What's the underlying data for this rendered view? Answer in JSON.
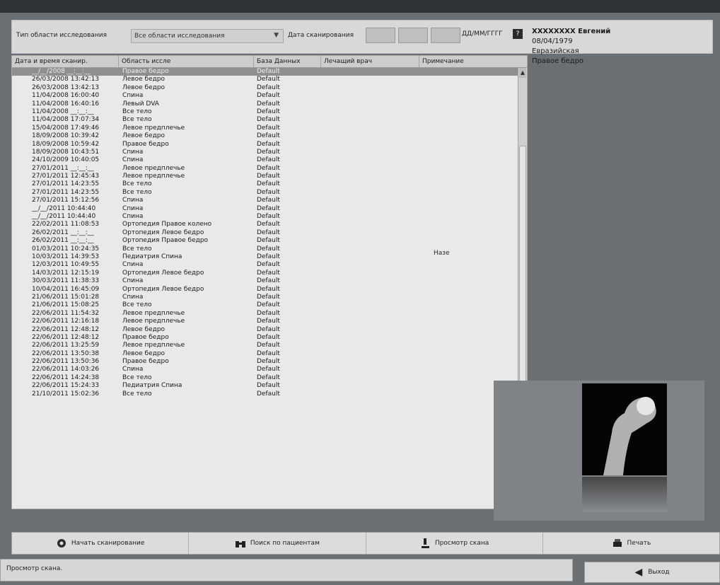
{
  "filters": {
    "exam_type_label": "Тип области исследования",
    "exam_type_value": "Все области исследования",
    "scan_date_label": "Дата сканирования",
    "date_format": "ДД/ММ/ГГГГ"
  },
  "patient": {
    "name": "XXXXXXXX Евгений",
    "dob": "08/04/1979",
    "ethnicity": "Евразийская",
    "region": "Правое бедро"
  },
  "table": {
    "headers": [
      "Дата и время сканир.",
      "Область иссле",
      "База Данных",
      "Лечащий врач",
      "Примечание"
    ],
    "comment": "Назе",
    "rows": [
      [
        "__/__/2008 __:__:__",
        "Правое бедро",
        "Default"
      ],
      [
        "26/03/2008 13:42:13",
        "Левое бедро",
        "Default"
      ],
      [
        "26/03/2008 13:42:13",
        "Левое бедро",
        "Default"
      ],
      [
        "11/04/2008 16:00:40",
        "Спина",
        "Default"
      ],
      [
        "11/04/2008 16:40:16",
        "Левый DVA",
        "Default"
      ],
      [
        "11/04/2008 __:__:__",
        "Все тело",
        "Default"
      ],
      [
        "11/04/2008 17:07:34",
        "Все тело",
        "Default"
      ],
      [
        "15/04/2008 17:49:46",
        "Левое предплечье",
        "Default"
      ],
      [
        "18/09/2008 10:39:42",
        "Левое бедро",
        "Default"
      ],
      [
        "18/09/2008 10:59:42",
        "Правое бедро",
        "Default"
      ],
      [
        "18/09/2008 10:43:51",
        "Спина",
        "Default"
      ],
      [
        "24/10/2009 10:40:05",
        "Спина",
        "Default"
      ],
      [
        "27/01/2011 __:__:__",
        "Левое предплечье",
        "Default"
      ],
      [
        "27/01/2011 12:45:43",
        "Левое предплечье",
        "Default"
      ],
      [
        "27/01/2011 14:23:55",
        "Все тело",
        "Default"
      ],
      [
        "27/01/2011 14:23:55",
        "Все тело",
        "Default"
      ],
      [
        "27/01/2011 15:12:56",
        "Спина",
        "Default"
      ],
      [
        "__/__/2011 10:44:40",
        "Спина",
        "Default"
      ],
      [
        "__/__/2011 10:44:40",
        "Спина",
        "Default"
      ],
      [
        "22/02/2011 11:08:53",
        "Ортопедия Правое колено",
        "Default"
      ],
      [
        "26/02/2011 __:__:__",
        "Ортопедия Левое бедро",
        "Default"
      ],
      [
        "26/02/2011 __:__:__",
        "Ортопедия Правое бедро",
        "Default"
      ],
      [
        "01/03/2011 10:24:35",
        "Все тело",
        "Default"
      ],
      [
        "10/03/2011 14:39:53",
        "Педиатрия Спина",
        "Default"
      ],
      [
        "12/03/2011 10:49:55",
        "Спина",
        "Default"
      ],
      [
        "14/03/2011 12:15:19",
        "Ортопедия Левое бедро",
        "Default"
      ],
      [
        "30/03/2011 11:38:33",
        "Спина",
        "Default"
      ],
      [
        "10/04/2011 16:45:09",
        "Ортопедия Левое бедро",
        "Default"
      ],
      [
        "21/06/2011 15:01:28",
        "Спина",
        "Default"
      ],
      [
        "21/06/2011 15:08:25",
        "Все тело",
        "Default"
      ],
      [
        "22/06/2011 11:54:32",
        "Левое предплечье",
        "Default"
      ],
      [
        "22/06/2011 12:16:18",
        "Левое предплечье",
        "Default"
      ],
      [
        "22/06/2011 12:48:12",
        "Левое бедро",
        "Default"
      ],
      [
        "22/06/2011 12:48:12",
        "Правое бедро",
        "Default"
      ],
      [
        "22/06/2011 13:25:59",
        "Левое предплечье",
        "Default"
      ],
      [
        "22/06/2011 13:50:38",
        "Левое бедро",
        "Default"
      ],
      [
        "22/06/2011 13:50:36",
        "Правое бедро",
        "Default"
      ],
      [
        "22/06/2011 14:03:26",
        "Спина",
        "Default"
      ],
      [
        "22/06/2011 14:24:38",
        "Все тело",
        "Default"
      ],
      [
        "22/06/2011 15:24:33",
        "Педиатрия Спина",
        "Default"
      ],
      [
        "21/10/2011 15:02:36",
        "Все тело",
        "Default"
      ]
    ]
  },
  "toolbar": {
    "start_scan": "Начать сканирование",
    "search_patient": "Поиск по пациентам",
    "view_scan": "Просмотр скана",
    "print": "Печать"
  },
  "status": {
    "text": "Просмотр скана.",
    "exit_label": "Выход"
  }
}
